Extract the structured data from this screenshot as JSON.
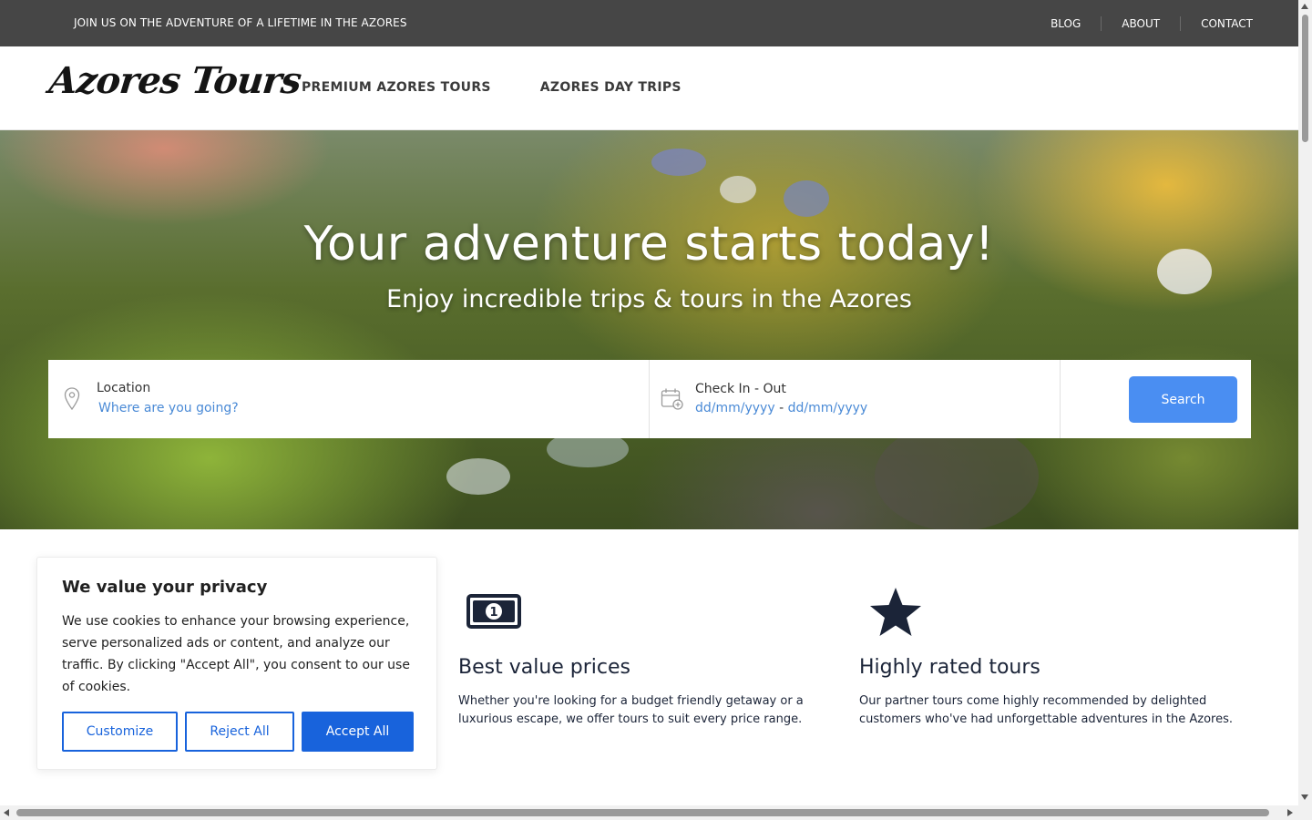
{
  "topbar": {
    "promo": "JOIN US ON THE ADVENTURE OF A LIFETIME IN THE AZORES",
    "links": [
      "BLOG",
      "ABOUT",
      "CONTACT"
    ]
  },
  "header": {
    "logo": "Azores Tours",
    "nav": [
      "PREMIUM AZORES TOURS",
      "AZORES DAY TRIPS"
    ]
  },
  "hero": {
    "title": "Your adventure starts today!",
    "subtitle": "Enjoy incredible trips & tours in the Azores"
  },
  "search": {
    "location_label": "Location",
    "location_placeholder": "Where are you going?",
    "dates_label": "Check In - Out",
    "check_in": "dd/mm/yyyy",
    "separator": "-",
    "check_out": "dd/mm/yyyy",
    "button": "Search"
  },
  "features": [
    {
      "icon": "banknote-icon",
      "title": "Best value prices",
      "text": "Whether you're looking for a budget friendly getaway or a luxurious escape, we offer tours to suit every price range."
    },
    {
      "icon": "star-icon",
      "title": "Highly rated tours",
      "text": "Our partner tours come highly recommended by delighted customers who've had unforgettable adventures in the Azores."
    }
  ],
  "cookie": {
    "title": "We value your privacy",
    "text": "We use cookies to enhance your browsing experience, serve personalized ads or content, and analyze our traffic. By clicking \"Accept All\", you consent to our use of cookies.",
    "customize": "Customize",
    "reject": "Reject All",
    "accept": "Accept All"
  },
  "colors": {
    "topbar": "#464646",
    "link_blue": "#4a8ad6",
    "search_button": "#4a8ef2",
    "cookie_blue": "#1863dc",
    "navy": "#1b2438"
  }
}
